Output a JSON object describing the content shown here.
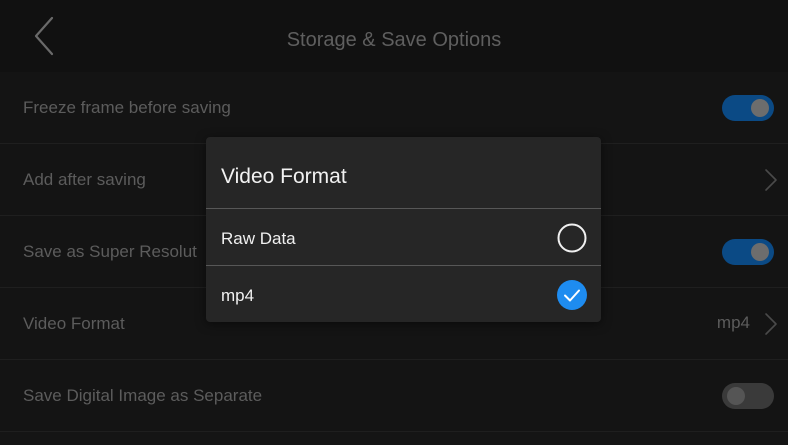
{
  "header": {
    "title": "Storage & Save Options",
    "back_icon": "chevron-left-icon"
  },
  "settings": {
    "freeze_frame": {
      "label": "Freeze frame before saving",
      "enabled": true
    },
    "add_after_saving": {
      "label": "Add after saving"
    },
    "super_resolution": {
      "label": "Save as Super Resolut",
      "enabled": true
    },
    "video_format": {
      "label": "Video Format",
      "value": "mp4"
    },
    "digital_image": {
      "label": "Save Digital Image as Separate",
      "enabled": false
    }
  },
  "dialog": {
    "title": "Video Format",
    "options": [
      {
        "label": "Raw Data",
        "selected": false
      },
      {
        "label": "mp4",
        "selected": true
      }
    ]
  },
  "colors": {
    "accent": "#1e8cf0",
    "toggle_on": "#0b4a85",
    "dialog_bg": "#262626"
  }
}
